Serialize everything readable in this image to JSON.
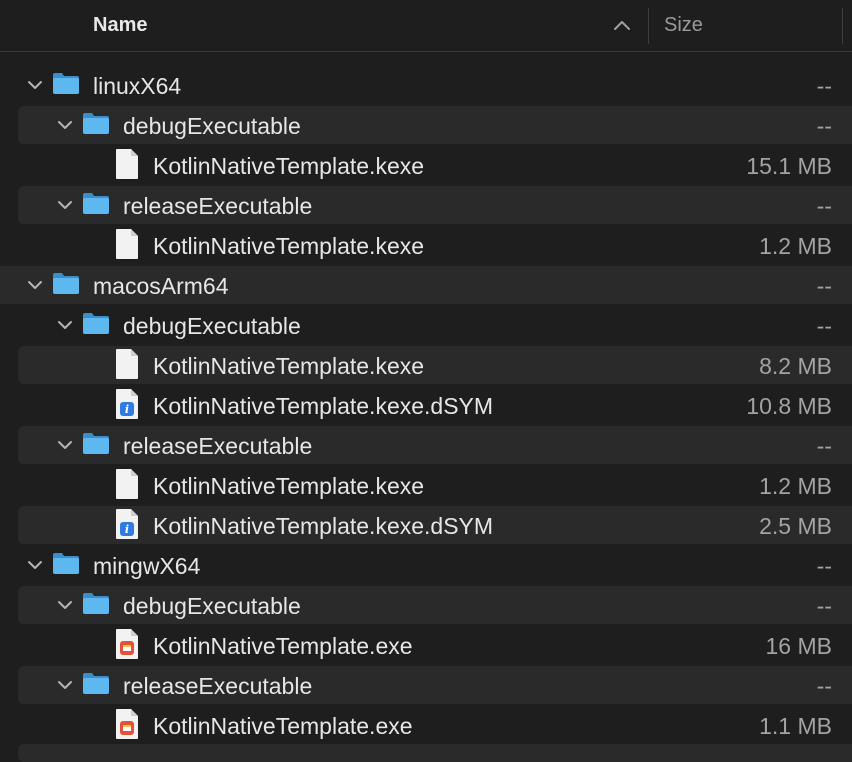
{
  "header": {
    "name_label": "Name",
    "size_label": "Size"
  },
  "rows": [
    {
      "type": "folder",
      "depth": 0,
      "name": "linuxX64",
      "size": "--"
    },
    {
      "type": "folder",
      "depth": 1,
      "name": "debugExecutable",
      "size": "--"
    },
    {
      "type": "file",
      "icon": "blank-document-icon",
      "name": "KotlinNativeTemplate.kexe",
      "size": "15.1 MB"
    },
    {
      "type": "folder",
      "depth": 1,
      "name": "releaseExecutable",
      "size": "--"
    },
    {
      "type": "file",
      "icon": "blank-document-icon",
      "name": "KotlinNativeTemplate.kexe",
      "size": "1.2 MB"
    },
    {
      "type": "folder",
      "depth": 0,
      "name": "macosArm64",
      "size": "--"
    },
    {
      "type": "folder",
      "depth": 1,
      "name": "debugExecutable",
      "size": "--"
    },
    {
      "type": "file",
      "icon": "blank-document-icon",
      "name": "KotlinNativeTemplate.kexe",
      "size": "8.2 MB"
    },
    {
      "type": "file",
      "icon": "dsym-document-icon",
      "name": "KotlinNativeTemplate.kexe.dSYM",
      "size": "10.8 MB"
    },
    {
      "type": "folder",
      "depth": 1,
      "name": "releaseExecutable",
      "size": "--"
    },
    {
      "type": "file",
      "icon": "blank-document-icon",
      "name": "KotlinNativeTemplate.kexe",
      "size": "1.2 MB"
    },
    {
      "type": "file",
      "icon": "dsym-document-icon",
      "name": "KotlinNativeTemplate.kexe.dSYM",
      "size": "2.5 MB"
    },
    {
      "type": "folder",
      "depth": 0,
      "name": "mingwX64",
      "size": "--"
    },
    {
      "type": "folder",
      "depth": 1,
      "name": "debugExecutable",
      "size": "--"
    },
    {
      "type": "file",
      "icon": "exe-document-icon",
      "name": "KotlinNativeTemplate.exe",
      "size": "16 MB"
    },
    {
      "type": "folder",
      "depth": 1,
      "name": "releaseExecutable",
      "size": "--"
    },
    {
      "type": "file",
      "icon": "exe-document-icon",
      "name": "KotlinNativeTemplate.exe",
      "size": "1.1 MB"
    }
  ],
  "colors": {
    "background": "#1e1e1e",
    "stripe": "#2a2a2a",
    "folder_blue": "#5cb8ee",
    "text": "#e6e6e6",
    "secondary_text": "#a3a3a3"
  }
}
